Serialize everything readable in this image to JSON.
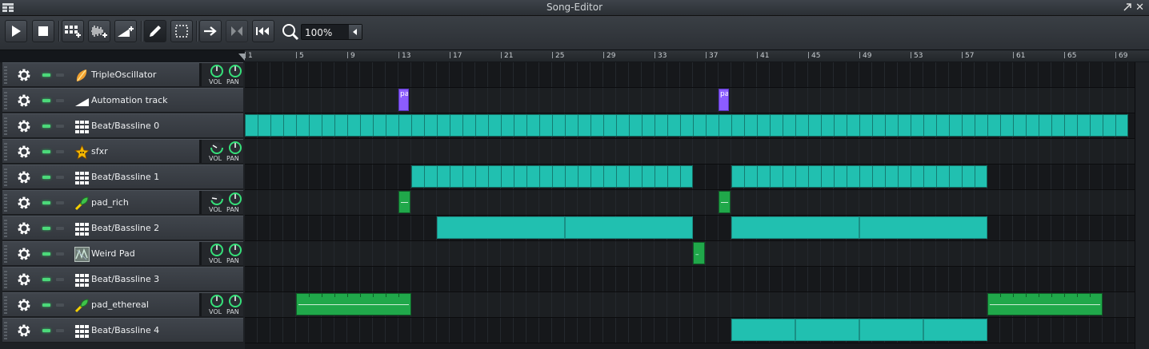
{
  "window": {
    "title": "Song-Editor"
  },
  "toolbar": {
    "zoom": "100%",
    "icons": [
      "play-icon",
      "stop-icon",
      "add-beat-bassline-icon",
      "add-sample-track-icon",
      "add-automation-track-icon",
      "draw-mode-icon",
      "select-mode-icon",
      "auto-scroll-icon",
      "loop-points-icon",
      "stop-behaviour-icon",
      "zoom-icon"
    ]
  },
  "ruler": {
    "ticks": [
      "1",
      "5",
      "9",
      "13",
      "17",
      "21",
      "25",
      "29",
      "33",
      "37",
      "41",
      "45",
      "49",
      "53",
      "57",
      "61",
      "65",
      "69"
    ]
  },
  "knob_labels": {
    "vol": "VOL",
    "pan": "PAN"
  },
  "tracks": [
    {
      "name": "TripleOscillator",
      "icon": "triple-oscillator-icon",
      "type": "instrument"
    },
    {
      "name": "Automation track",
      "icon": "automation-track-icon",
      "type": "automation"
    },
    {
      "name": "Beat/Bassline 0",
      "icon": "beat-bassline-icon",
      "type": "bb"
    },
    {
      "name": "sfxr",
      "icon": "sfxr-star-icon",
      "type": "instrument"
    },
    {
      "name": "Beat/Bassline 1",
      "icon": "beat-bassline-icon",
      "type": "bb"
    },
    {
      "name": "pad_rich",
      "icon": "sample-pad-icon",
      "type": "instrument"
    },
    {
      "name": "Beat/Bassline 2",
      "icon": "beat-bassline-icon",
      "type": "bb"
    },
    {
      "name": "Weird Pad",
      "icon": "weird-pad-icon",
      "type": "instrument"
    },
    {
      "name": "Beat/Bassline 3",
      "icon": "beat-bassline-icon",
      "type": "bb"
    },
    {
      "name": "pad_ethereal",
      "icon": "sample-pad-icon",
      "type": "instrument"
    },
    {
      "name": "Beat/Bassline 4",
      "icon": "beat-bassline-icon",
      "type": "bb"
    }
  ],
  "clips": {
    "automation_label": "pa",
    "note_mark": "–"
  },
  "colors": {
    "bb_clip": "#21c0b0",
    "automation_clip": "#8c5cff",
    "instrument_clip": "#20a84a",
    "led": "#4cd97a"
  }
}
